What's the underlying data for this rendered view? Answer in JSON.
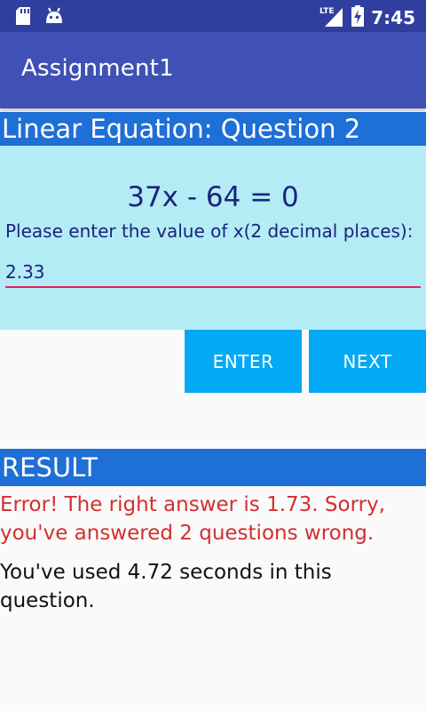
{
  "status_bar": {
    "time": "7:45",
    "network": "LTE",
    "icons": [
      "sd-card-icon",
      "android-icon",
      "signal-icon",
      "battery-charging-icon"
    ]
  },
  "app": {
    "title": "Assignment1"
  },
  "question": {
    "header": "Linear Equation: Question 2",
    "equation": "37x - 64 = 0",
    "prompt": "Please enter the value of x(2 decimal places):",
    "input_value": "2.33"
  },
  "buttons": {
    "enter": "ENTER",
    "next": "NEXT"
  },
  "result": {
    "header": "RESULT",
    "error_message": "Error! The right answer is 1.73. Sorry, you've answered 2 questions wrong.",
    "time_message": "You've used 4.72 seconds in this question."
  },
  "colors": {
    "status_bar": "#303f9f",
    "app_bar": "#3f51b5",
    "section_header": "#1e6fd6",
    "question_panel": "#b3ecf5",
    "button": "#03a9f4",
    "input_underline": "#e91e63",
    "error_text": "#d32f2f"
  }
}
